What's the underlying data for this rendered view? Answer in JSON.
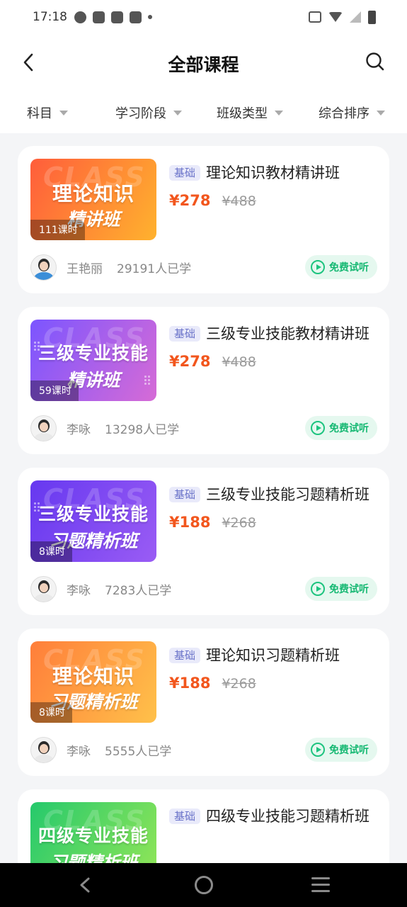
{
  "status_bar": {
    "time": "17:18",
    "icons": [
      "speed-icon",
      "mail-icon",
      "mail-icon",
      "mail-icon",
      "dot-icon",
      "vibrate-icon",
      "wifi-icon",
      "signal-icon",
      "battery-icon"
    ]
  },
  "header": {
    "title": "全部课程",
    "back_icon": "chevron-left-icon",
    "search_icon": "search-icon"
  },
  "filters": [
    {
      "label": "科目"
    },
    {
      "label": "学习阶段"
    },
    {
      "label": "班级类型"
    },
    {
      "label": "综合排序"
    }
  ],
  "courses": [
    {
      "thumb_line1": "理论知识",
      "thumb_line2": "精讲班",
      "thumb_bg": "CLASS",
      "hours": "111课时",
      "tag": "基础",
      "title": "理论知识教材精讲班",
      "price": "¥278",
      "old_price": "¥488",
      "teacher": "王艳丽",
      "learners": "29191人已学",
      "trial_label": "免费试听",
      "gradient": [
        "#ff6a3d",
        "#ffb92e"
      ]
    },
    {
      "thumb_line1": "三级专业技能",
      "thumb_line2": "精讲班",
      "thumb_bg": "CLASS",
      "hours": "59课时",
      "tag": "基础",
      "title": "三级专业技能教材精讲班",
      "price": "¥278",
      "old_price": "¥488",
      "teacher": "李咏",
      "learners": "13298人已学",
      "trial_label": "免费试听",
      "gradient": [
        "#7e57ff",
        "#d46ad8"
      ]
    },
    {
      "thumb_line1": "三级专业技能",
      "thumb_line2": "习题精析班",
      "thumb_bg": "CLASS",
      "hours": "8课时",
      "tag": "基础",
      "title": "三级专业技能习题精析班",
      "price": "¥188",
      "old_price": "¥268",
      "teacher": "李咏",
      "learners": "7283人已学",
      "trial_label": "免费试听",
      "gradient": [
        "#6a3cf2",
        "#8a53f0"
      ]
    },
    {
      "thumb_line1": "理论知识",
      "thumb_line2": "习题精析班",
      "thumb_bg": "CLASS",
      "hours": "8课时",
      "tag": "基础",
      "title": "理论知识习题精析班",
      "price": "¥188",
      "old_price": "¥268",
      "teacher": "李咏",
      "learners": "5555人已学",
      "trial_label": "免费试听",
      "gradient": [
        "#ff8a3d",
        "#ffc24a"
      ]
    },
    {
      "thumb_line1": "四级专业技能",
      "thumb_line2": "习题精析班",
      "thumb_bg": "CLASS",
      "hours": "",
      "tag": "基础",
      "title": "四级专业技能习题精析班",
      "price": "",
      "old_price": "",
      "teacher": "",
      "learners": "",
      "trial_label": "",
      "gradient": [
        "#2fcf6e",
        "#8be35a"
      ]
    }
  ],
  "nav_bar": {
    "icons": [
      "back-icon",
      "home-icon",
      "menu-icon"
    ]
  }
}
